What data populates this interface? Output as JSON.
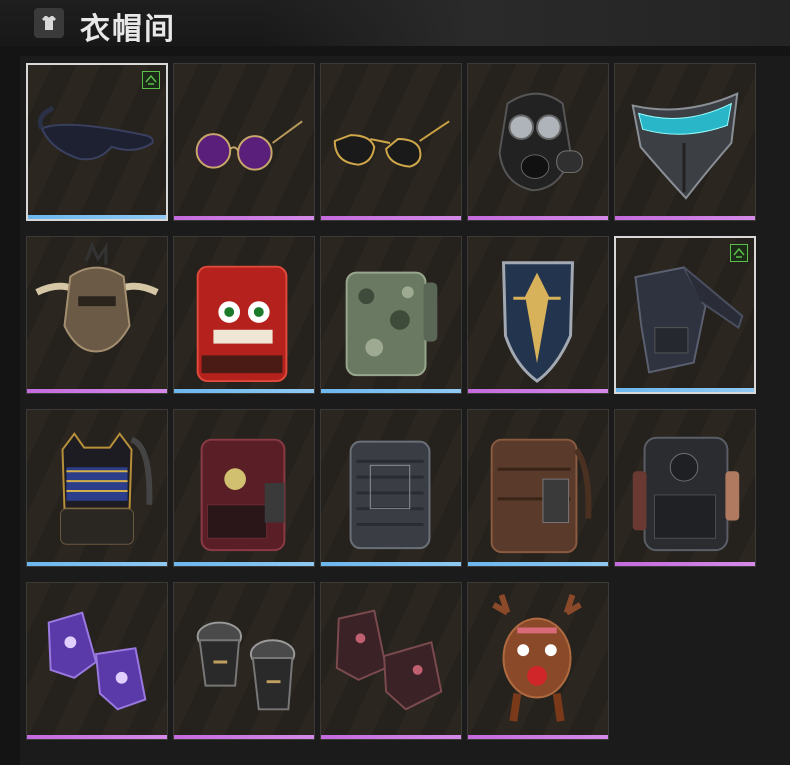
{
  "header": {
    "title": "衣帽间",
    "icon": "wardrobe-icon"
  },
  "rarity_colors": {
    "blue": "#6bb7ee",
    "purple": "#c46bde"
  },
  "items": [
    {
      "name": "sunglasses-wrap",
      "rarity": "blue",
      "owned_badge": true,
      "selected": true
    },
    {
      "name": "round-purple-sunglasses",
      "rarity": "purple",
      "owned_badge": false
    },
    {
      "name": "aviator-sunglasses",
      "rarity": "purple",
      "owned_badge": false
    },
    {
      "name": "gas-mask",
      "rarity": "purple",
      "owned_badge": false
    },
    {
      "name": "cyber-visor-mask",
      "rarity": "purple",
      "owned_badge": false
    },
    {
      "name": "horned-tribal-helmet",
      "rarity": "purple",
      "owned_badge": false
    },
    {
      "name": "lion-dance-backpack",
      "rarity": "blue",
      "owned_badge": false
    },
    {
      "name": "camo-backpack",
      "rarity": "blue",
      "owned_badge": false
    },
    {
      "name": "shield-backpack",
      "rarity": "purple",
      "owned_badge": false
    },
    {
      "name": "sling-bag",
      "rarity": "blue",
      "owned_badge": true,
      "selected": true
    },
    {
      "name": "pharaoh-backpack",
      "rarity": "blue",
      "owned_badge": false
    },
    {
      "name": "red-tactical-backpack",
      "rarity": "blue",
      "owned_badge": false
    },
    {
      "name": "grey-tactical-backpack",
      "rarity": "blue",
      "owned_badge": false
    },
    {
      "name": "brown-tactical-backpack",
      "rarity": "blue",
      "owned_badge": false
    },
    {
      "name": "black-tactical-backpack",
      "rarity": "purple",
      "owned_badge": false
    },
    {
      "name": "purple-gloves",
      "rarity": "purple",
      "owned_badge": false
    },
    {
      "name": "armored-gloves",
      "rarity": "purple",
      "owned_badge": false
    },
    {
      "name": "dark-red-gloves",
      "rarity": "purple",
      "owned_badge": false
    },
    {
      "name": "reindeer-hat",
      "rarity": "purple",
      "owned_badge": false
    }
  ]
}
